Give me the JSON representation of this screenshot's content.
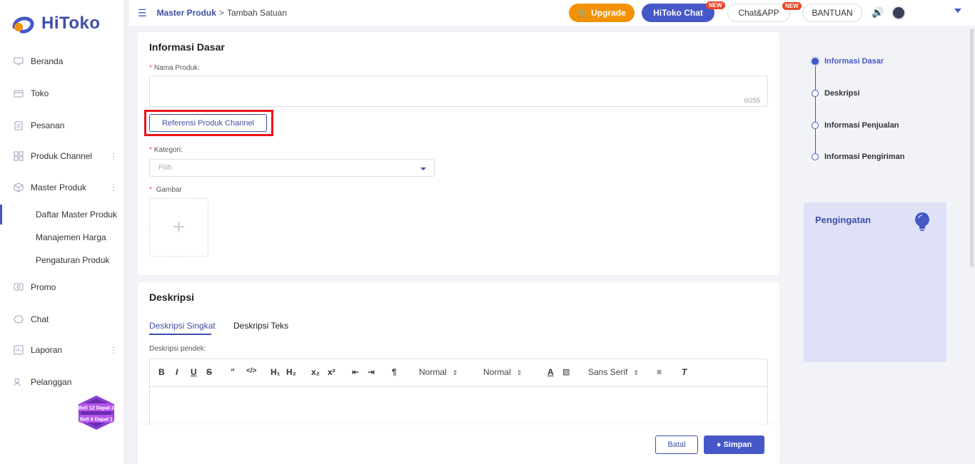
{
  "brand": {
    "name": "HiToko",
    "color": "#3f4fa8"
  },
  "sidebar": {
    "items": [
      {
        "label": "Beranda",
        "icon": "monitor-icon"
      },
      {
        "label": "Toko",
        "icon": "store-icon"
      },
      {
        "label": "Pesanan",
        "icon": "clipboard-icon"
      },
      {
        "label": "Produk Channel",
        "icon": "grid-icon"
      },
      {
        "label": "Master Produk",
        "icon": "cube-icon"
      },
      {
        "label": "Promo",
        "icon": "promo-icon"
      },
      {
        "label": "Chat",
        "icon": "chat-bubble-icon"
      },
      {
        "label": "Laporan",
        "icon": "report-icon"
      },
      {
        "label": "Pelanggan",
        "icon": "users-icon"
      }
    ],
    "sub_items": [
      {
        "label": "Daftar Master Produk"
      },
      {
        "label": "Manajemen Harga"
      },
      {
        "label": "Pengaturan Produk"
      }
    ],
    "promo_badge": {
      "line1": "Beli 12 Dapat 2",
      "line2": "Beli 6 Dapat 1"
    }
  },
  "topbar": {
    "breadcrumb_parent": "Master Produk",
    "breadcrumb_sep": ">",
    "breadcrumb_current": "Tambah Satuan",
    "upgrade": "Upgrade",
    "hitoko_chat": "HiToko Chat",
    "chat_app": "Chat&APP",
    "bantuan": "BANTUAN",
    "new_tag": "NEW"
  },
  "basic_info": {
    "title": "Informasi Dasar",
    "name_label": "Nama Produk:",
    "name_counter": "0/255",
    "ref_button": "Referensi Produk Channel",
    "category_label": "Kategori:",
    "category_placeholder": "Pilih",
    "image_label": "Gambar",
    "required_mark": "*"
  },
  "description": {
    "title": "Deskripsi",
    "tabs": [
      "Deskripsi Singkat",
      "Deskripsi Teks"
    ],
    "short_label": "Deskripsi pendek:",
    "toolbar": {
      "header_select": "Normal",
      "size_select": "Normal",
      "font_select": "Sans Serif"
    }
  },
  "actions": {
    "cancel": "Batal",
    "save": "Simpan"
  },
  "steps": [
    "Informasi Dasar",
    "Deskripsi",
    "Informasi Penjualan",
    "Informasi Pengiriman"
  ],
  "reminder": {
    "title": "Pengingatan"
  }
}
